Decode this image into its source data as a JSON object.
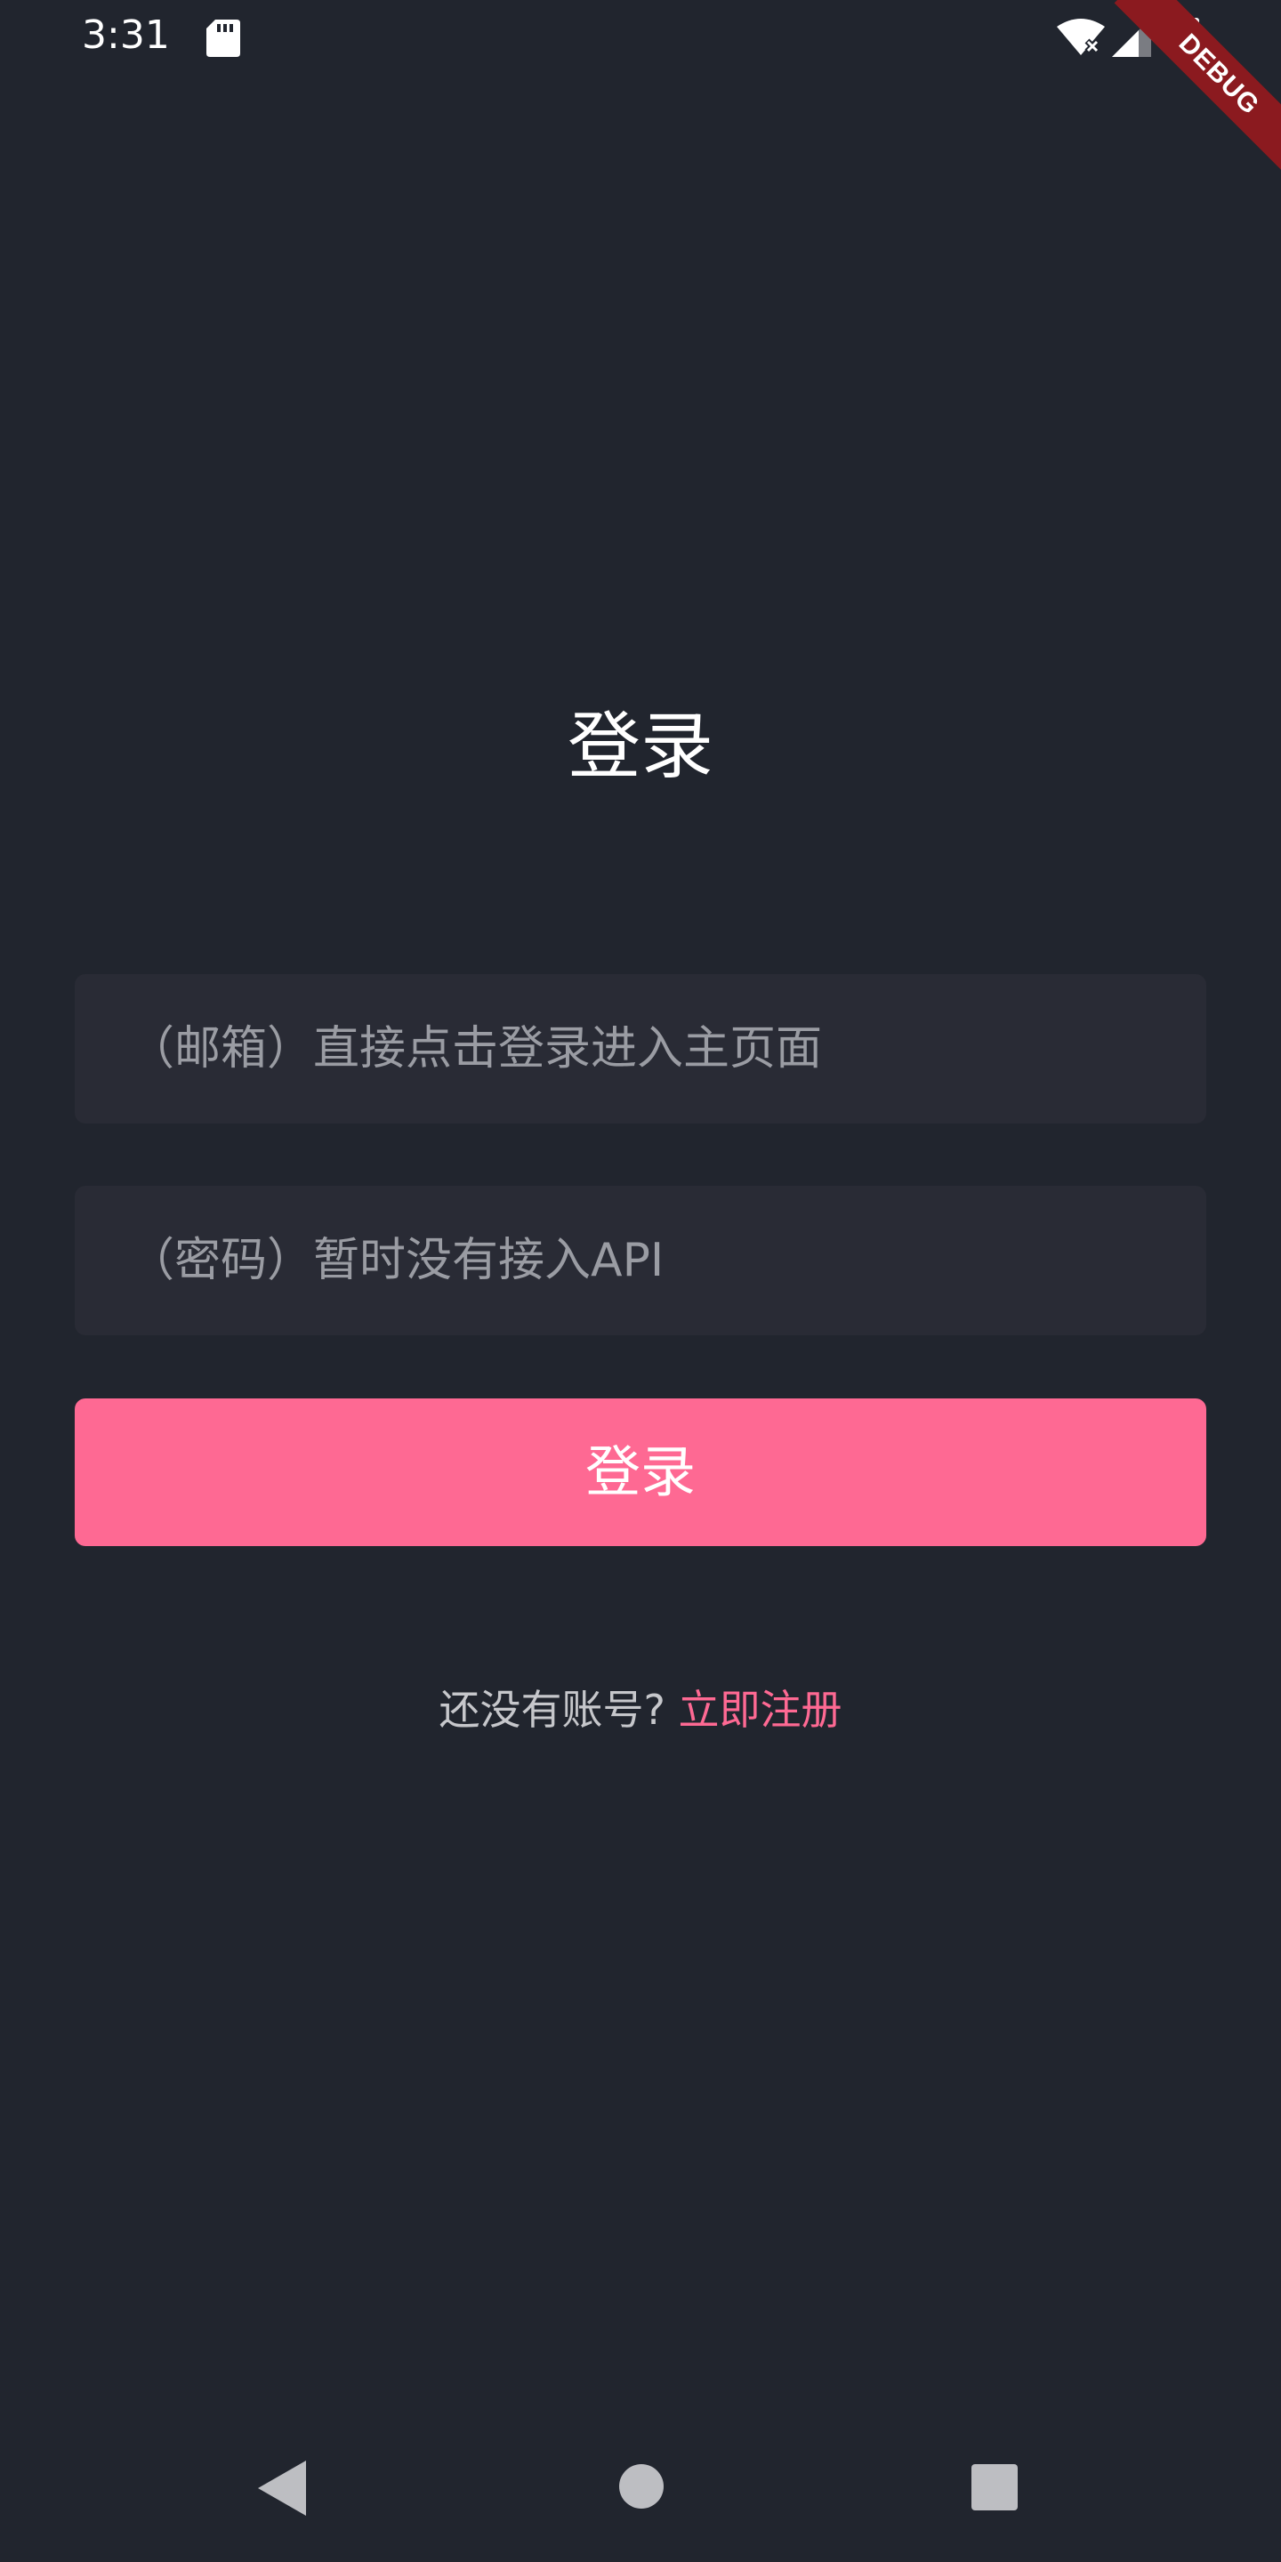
{
  "status_bar": {
    "time": "3:31",
    "icons": [
      "sd-card-icon",
      "wifi-icon",
      "signal-icon",
      "battery-charging-icon"
    ]
  },
  "debug_banner": {
    "label": "DEBUG"
  },
  "title": "登录",
  "email_field": {
    "placeholder": "（邮箱）直接点击登录进入主页面",
    "value": ""
  },
  "password_field": {
    "placeholder": "（密码）暂时没有接入API",
    "value": ""
  },
  "login_button": {
    "label": "登录"
  },
  "register": {
    "prompt": "还没有账号? ",
    "link": "立即注册"
  },
  "nav_bar": {
    "icons": [
      "back-icon",
      "home-icon",
      "recents-icon"
    ]
  },
  "colors": {
    "background": "#21252e",
    "field_background": "#292b35",
    "accent": "#fe6993",
    "debug_banner": "#8b1a1f"
  }
}
